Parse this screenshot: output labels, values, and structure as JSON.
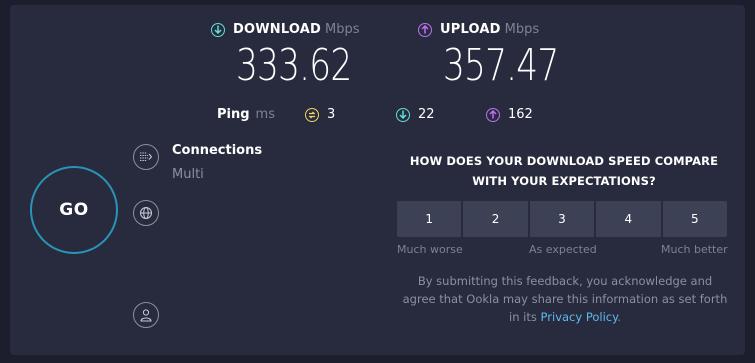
{
  "download": {
    "label": "DOWNLOAD",
    "unit": "Mbps",
    "value": "333.62"
  },
  "upload": {
    "label": "UPLOAD",
    "unit": "Mbps",
    "value": "357.47"
  },
  "ping": {
    "label": "Ping",
    "unit": "ms",
    "idle": "3",
    "download": "22",
    "upload": "162"
  },
  "go_label": "GO",
  "connections": {
    "title": "Connections",
    "value": "Multi"
  },
  "survey": {
    "question": "HOW DOES YOUR DOWNLOAD SPEED COMPARE WITH YOUR EXPECTATIONS?",
    "options": [
      "1",
      "2",
      "3",
      "4",
      "5"
    ],
    "scale_low": "Much worse",
    "scale_mid": "As expected",
    "scale_high": "Much better",
    "disclaimer_prefix": "By submitting this feedback, you acknowledge and agree that Ookla may share this information as set forth in its",
    "privacy_link": "Privacy Policy",
    "disclaimer_suffix": "."
  },
  "icons": {
    "download": "download-arrow-icon",
    "upload": "upload-arrow-icon",
    "ping": "ping-icon",
    "connections": "connections-icon",
    "server": "globe-icon",
    "user": "user-icon"
  },
  "colors": {
    "download": "#5fe0d6",
    "upload": "#bf71f2",
    "ping": "#f1d466",
    "go_ring": "#2a94b8",
    "link": "#5eb8f2"
  }
}
